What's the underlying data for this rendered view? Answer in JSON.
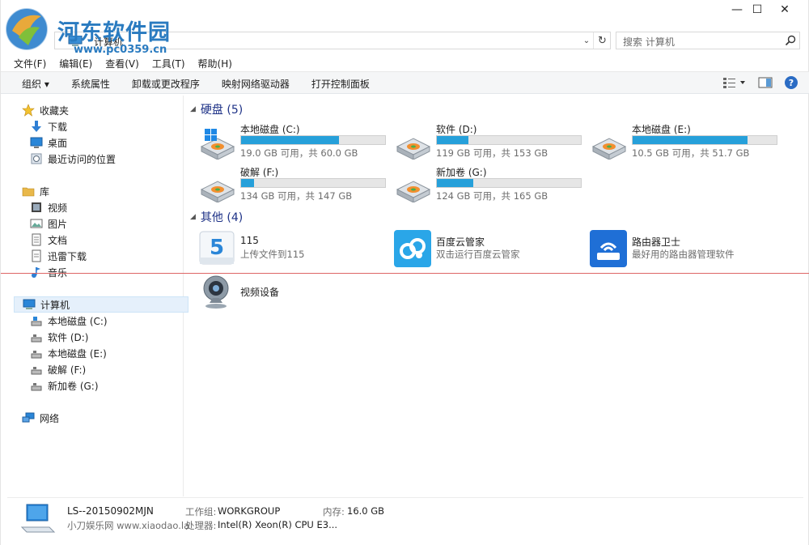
{
  "watermark": {
    "text": "河东软件园",
    "url": "www.pc0359.cn"
  },
  "window": {
    "minimize": "—",
    "maximize": "☐",
    "close": "✕"
  },
  "address": {
    "path": "计算机",
    "search_placeholder": "搜索 计算机"
  },
  "menu": [
    "文件(F)",
    "编辑(E)",
    "查看(V)",
    "工具(T)",
    "帮助(H)"
  ],
  "toolbar": [
    "组织 ▾",
    "系统属性",
    "卸载或更改程序",
    "映射网络驱动器",
    "打开控制面板"
  ],
  "nav": {
    "favorites": {
      "label": "收藏夹",
      "items": [
        "下载",
        "桌面",
        "最近访问的位置"
      ]
    },
    "libraries": {
      "label": "库",
      "items": [
        "视频",
        "图片",
        "文档",
        "迅雷下载",
        "音乐"
      ]
    },
    "computer": {
      "label": "计算机",
      "items": [
        "本地磁盘 (C:)",
        "软件 (D:)",
        "本地磁盘 (E:)",
        "破解 (F:)",
        "新加卷 (G:)"
      ]
    },
    "network": {
      "label": "网络"
    }
  },
  "groups": {
    "drives_header": "硬盘 (5)",
    "other_header": "其他 (4)"
  },
  "drives": [
    {
      "name": "本地磁盘 (C:)",
      "free": "19.0 GB 可用，共 60.0 GB",
      "used_fraction": 0.68,
      "windows": true
    },
    {
      "name": "软件 (D:)",
      "free": "119 GB 可用，共 153 GB",
      "used_fraction": 0.22
    },
    {
      "name": "本地磁盘 (E:)",
      "free": "10.5 GB 可用，共 51.7 GB",
      "used_fraction": 0.8
    },
    {
      "name": "破解 (F:)",
      "free": "134 GB 可用，共 147 GB",
      "used_fraction": 0.09
    },
    {
      "name": "新加卷 (G:)",
      "free": "124 GB 可用，共 165 GB",
      "used_fraction": 0.25
    }
  ],
  "others": [
    {
      "name": "115",
      "desc": "上传文件到115",
      "icon": "115-icon"
    },
    {
      "name": "百度云管家",
      "desc": "双击运行百度云管家",
      "icon": "baidu-cloud-icon"
    },
    {
      "name": "路由器卫士",
      "desc": "最好用的路由器管理软件",
      "icon": "router-guard-icon"
    },
    {
      "name": "视频设备",
      "desc": "",
      "icon": "webcam-icon"
    }
  ],
  "details": {
    "name": "LS--20150902MJN",
    "sub": "小刀娱乐网 www.xiaodao.la",
    "workgroup_key": "工作组:",
    "workgroup_val": "WORKGROUP",
    "memory_key": "内存:",
    "memory_val": "16.0 GB",
    "cpu_key": "处理器:",
    "cpu_val": "Intel(R) Xeon(R) CPU E3..."
  }
}
